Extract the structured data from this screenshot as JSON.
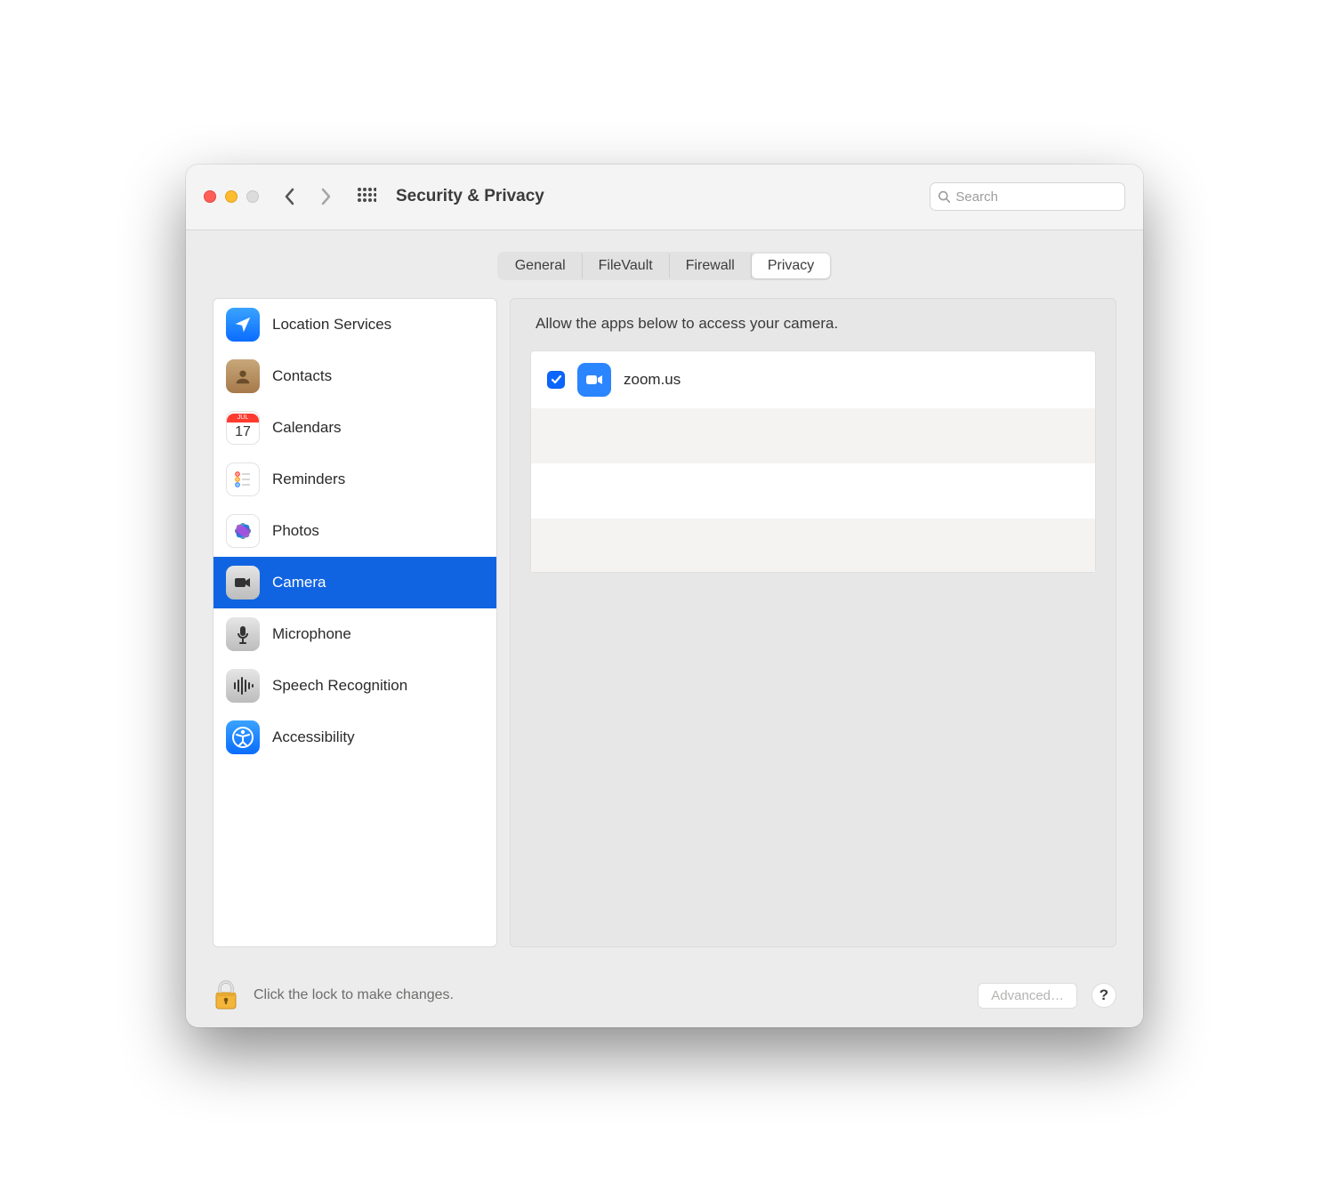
{
  "header": {
    "title": "Security & Privacy",
    "search_placeholder": "Search"
  },
  "tabs": [
    {
      "label": "General",
      "active": false
    },
    {
      "label": "FileVault",
      "active": false
    },
    {
      "label": "Firewall",
      "active": false
    },
    {
      "label": "Privacy",
      "active": true
    }
  ],
  "sidebar": {
    "items": [
      {
        "label": "Location Services",
        "selected": false,
        "icon": "location-icon"
      },
      {
        "label": "Contacts",
        "selected": false,
        "icon": "contacts-icon"
      },
      {
        "label": "Calendars",
        "selected": false,
        "icon": "calendar-icon"
      },
      {
        "label": "Reminders",
        "selected": false,
        "icon": "reminders-icon"
      },
      {
        "label": "Photos",
        "selected": false,
        "icon": "photos-icon"
      },
      {
        "label": "Camera",
        "selected": true,
        "icon": "camera-icon"
      },
      {
        "label": "Microphone",
        "selected": false,
        "icon": "microphone-icon"
      },
      {
        "label": "Speech Recognition",
        "selected": false,
        "icon": "speech-icon"
      },
      {
        "label": "Accessibility",
        "selected": false,
        "icon": "accessibility-icon"
      }
    ]
  },
  "detail": {
    "heading": "Allow the apps below to access your camera.",
    "apps": [
      {
        "name": "zoom.us",
        "checked": true,
        "icon": "zoom-icon"
      }
    ]
  },
  "footer": {
    "lock_text": "Click the lock to make changes.",
    "advanced_label": "Advanced…",
    "help_label": "?"
  }
}
